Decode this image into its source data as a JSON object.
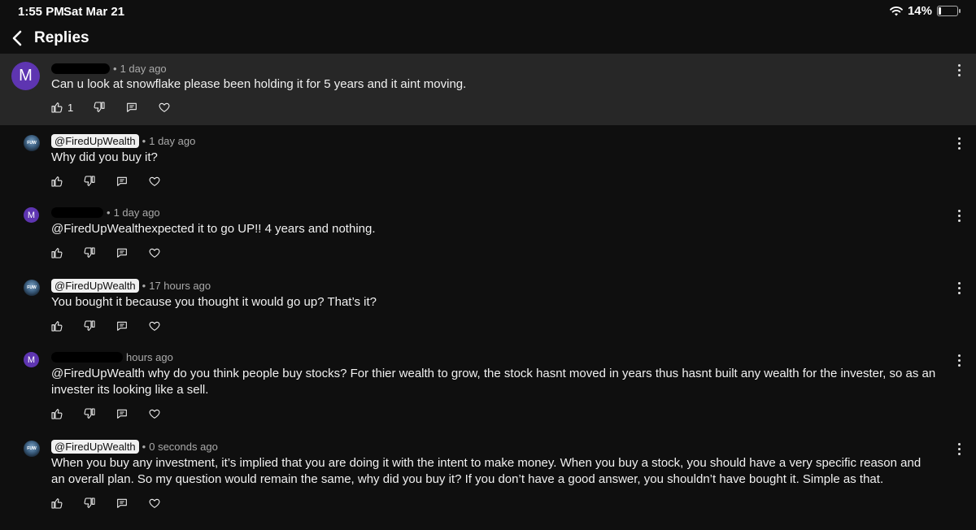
{
  "status_bar": {
    "time": "1:55 PM",
    "date": "Sat Mar 21",
    "battery": "14%",
    "battery_level": 0.14
  },
  "header": {
    "title": "Replies"
  },
  "colors": {
    "background": "#0f0f0f",
    "highlight": "#272727",
    "avatar": "#5e35b1"
  },
  "comments": [
    {
      "avatar": "M",
      "author": "",
      "time": "1 day ago",
      "text": "Can u look at snowflake please been holding it for 5 years and it aint moving.",
      "likes": "1"
    },
    {
      "avatar": "wealth-logo",
      "author": "@FiredUpWealth",
      "time": "1 day ago",
      "text": "Why did you buy it?",
      "likes": ""
    },
    {
      "avatar": "M",
      "author": "",
      "time": "1 day ago",
      "text": "@FiredUpWealthexpected it to go UP!! 4 years and nothing.",
      "likes": ""
    },
    {
      "avatar": "wealth-logo",
      "author": "@FiredUpWealth",
      "time": "17 hours ago",
      "text": "You bought it because you thought it would go up? That’s it?",
      "likes": ""
    },
    {
      "avatar": "M",
      "author": "",
      "time": "hours ago",
      "text": "@FiredUpWealth why do you think people buy stocks? For thier wealth to grow, the stock hasnt moved in years thus hasnt built any wealth for the invester, so as an invester its looking like a sell.",
      "likes": ""
    },
    {
      "avatar": "wealth-logo",
      "author": "@FiredUpWealth",
      "time": "0 seconds ago",
      "text": "When you buy any investment, it’s implied that you are doing it with the intent to make money. When you buy a stock, you should have a very specific reason and an overall plan. So my question would remain the same, why did you buy it? If you don’t have a good answer, you shouldn’t have bought it. Simple as that.",
      "likes": ""
    }
  ]
}
